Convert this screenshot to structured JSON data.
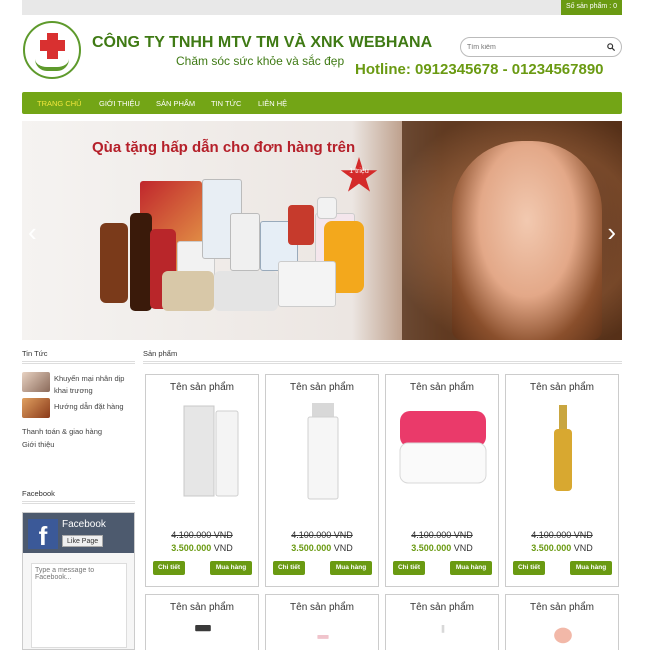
{
  "topbar": {
    "cart_label": "Số sản phẩm : 0"
  },
  "header": {
    "company": "CÔNG TY TNHH MTV TM VÀ XNK WEBHANA",
    "slogan": "Chăm sóc sức khỏe và sắc đẹp",
    "hotline": "Hotline: 0912345678 - 01234567890",
    "search_placeholder": "Tìm kiếm"
  },
  "nav": {
    "items": [
      {
        "label": "TRANG CHỦ",
        "active": true
      },
      {
        "label": "GIỚI THIỆU"
      },
      {
        "label": "SẢN PHẨM"
      },
      {
        "label": "TIN TỨC"
      },
      {
        "label": "LIÊN HỆ"
      }
    ]
  },
  "banner": {
    "headline": "Qùa tặng hấp dẫn cho đơn hàng trên",
    "badge": "1 triệu",
    "prev_icon": "chevron-left-icon",
    "next_icon": "chevron-right-icon"
  },
  "sidebar": {
    "news_title": "Tin Tức",
    "news": [
      {
        "label": "Khuyến mại nhân dịp khai trương"
      },
      {
        "label": "Hướng dẫn đặt hàng"
      }
    ],
    "links": [
      {
        "label": "Thanh toán & giao hàng"
      },
      {
        "label": "Giới thiệu"
      }
    ],
    "facebook_title": "Facebook",
    "facebook": {
      "page_name": "Facebook",
      "like_label": "Like Page",
      "message_placeholder": "Type a message to Facebook..."
    }
  },
  "main": {
    "title": "Sản phẩm",
    "products": [
      {
        "name": "Tên sản phẩm",
        "old_price": "4.100.000 VND",
        "price": "3.500.000",
        "currency": "VND",
        "detail_label": "Chi tiết",
        "buy_label": "Mua hàng"
      },
      {
        "name": "Tên sản phẩm",
        "old_price": "4.100.000 VND",
        "price": "3.500.000",
        "currency": "VND",
        "detail_label": "Chi tiết",
        "buy_label": "Mua hàng"
      },
      {
        "name": "Tên sản phẩm",
        "old_price": "4.100.000 VND",
        "price": "3.500.000",
        "currency": "VND",
        "detail_label": "Chi tiết",
        "buy_label": "Mua hàng"
      },
      {
        "name": "Tên sản phẩm",
        "old_price": "4.100.000 VND",
        "price": "3.500.000",
        "currency": "VND",
        "detail_label": "Chi tiết",
        "buy_label": "Mua hàng"
      },
      {
        "name": "Tên sản phẩm"
      },
      {
        "name": "Tên sản phẩm"
      },
      {
        "name": "Tên sản phẩm"
      },
      {
        "name": "Tên sản phẩm"
      }
    ]
  },
  "colors": {
    "brand_green": "#6a9a12",
    "nav_green": "#73a516",
    "active_nav": "#f0e63c",
    "cross_red": "#d93030"
  }
}
